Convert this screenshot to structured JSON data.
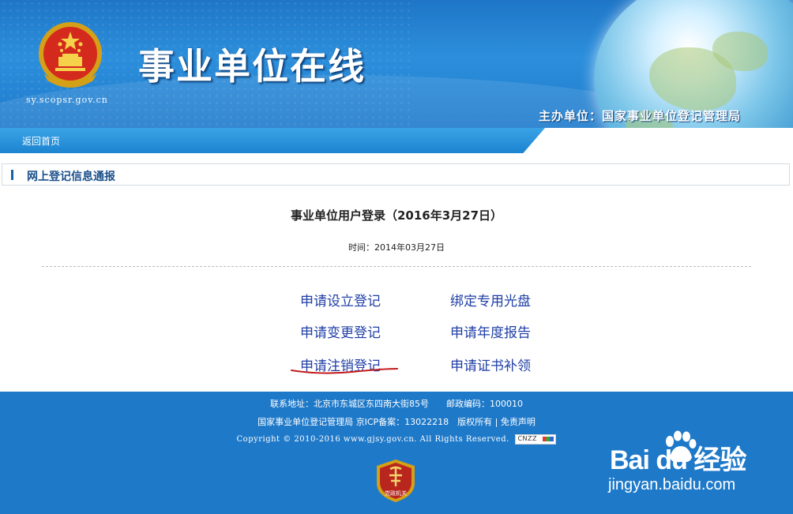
{
  "header": {
    "domain": "sy.scopsr.gov.cn",
    "site_title": "事业单位在线",
    "sponsor": "主办单位：国家事业单位登记管理局"
  },
  "nav": {
    "home_link": "返回首页"
  },
  "section": {
    "title": "网上登记信息通报"
  },
  "main": {
    "page_title": "事业单位用户登录（2016年3月27日）",
    "time_text": "时间：2014年03月27日",
    "links_left": [
      "申请设立登记",
      "申请变更登记",
      "申请注销登记"
    ],
    "links_right": [
      "绑定专用光盘",
      "申请年度报告",
      "申请证书补领"
    ]
  },
  "footer": {
    "address": "联系地址：北京市东城区东四南大街85号　　邮政编码：100010",
    "org_line": "国家事业单位登记管理局 京ICP备案：13022218　版权所有 | 免责声明",
    "copyright": "Copyright © 2010-2016 www.gjsy.gov.cn. All Rights Reserved.",
    "counter_label": "CNZZ",
    "badge_text": "党政机关"
  },
  "watermark": {
    "logo": "Bai du 经验",
    "url": "jingyan.baidu.com"
  },
  "colors": {
    "header_blue": "#1f76c7",
    "link_blue": "#1f3fa6",
    "footer_blue": "#1e79c9",
    "underline_red": "#c21a1a",
    "badge_red": "#b8261e"
  }
}
